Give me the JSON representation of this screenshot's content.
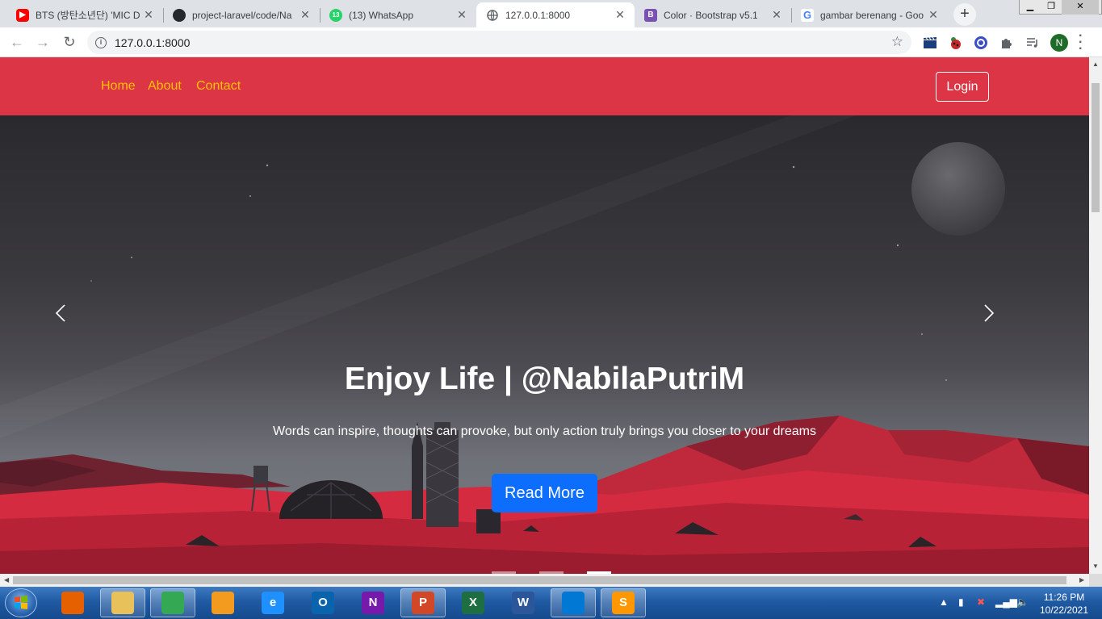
{
  "browser": {
    "tabs": [
      {
        "title": "BTS (방탄소년단) 'MIC D",
        "icon": "youtube-icon",
        "color": "#ff0000",
        "active": false
      },
      {
        "title": "project-laravel/code/Na",
        "icon": "github-icon",
        "color": "#24292e",
        "active": false
      },
      {
        "title": "(13) WhatsApp",
        "icon": "whatsapp-icon",
        "color": "#25d366",
        "badge": "13",
        "active": false
      },
      {
        "title": "127.0.0.1:8000",
        "icon": "globe-icon",
        "color": "#5f6368",
        "active": true
      },
      {
        "title": "Color · Bootstrap v5.1",
        "icon": "bootstrap-icon",
        "color": "#7952b3",
        "badge": "B",
        "active": false
      },
      {
        "title": "gambar berenang - Goo",
        "icon": "google-icon",
        "color": "#4285f4",
        "badge": "G",
        "active": false
      }
    ],
    "url": "127.0.0.1:8000",
    "profile_initial": "N"
  },
  "site": {
    "nav": {
      "links": [
        "Home",
        "About",
        "Contact"
      ],
      "login": "Login"
    },
    "hero": {
      "title": "Enjoy Life | @NabilaPutriM",
      "text": "Words can inspire, thoughts can provoke, but only action truly brings you closer to your dreams",
      "button": "Read More"
    },
    "carousel": {
      "slide_count": 3,
      "active_index": 2
    }
  },
  "colors": {
    "navbar": "#dc3545",
    "nav_link": "#ffc107",
    "button_primary": "#0d6efd"
  },
  "taskbar": {
    "apps": [
      {
        "name": "firefox-icon",
        "glyph": "",
        "color": "#e66000",
        "open": false
      },
      {
        "name": "file-explorer-icon",
        "glyph": "",
        "color": "#e8c15a",
        "open": true
      },
      {
        "name": "chrome-icon",
        "glyph": "",
        "color": "#34a853",
        "open": true
      },
      {
        "name": "media-player-icon",
        "glyph": "",
        "color": "#f29b1f",
        "open": false
      },
      {
        "name": "internet-explorer-icon",
        "glyph": "e",
        "color": "#1e90ff",
        "open": false
      },
      {
        "name": "outlook-icon",
        "glyph": "O",
        "color": "#0a64ad",
        "open": false
      },
      {
        "name": "onenote-icon",
        "glyph": "N",
        "color": "#7719aa",
        "open": false
      },
      {
        "name": "powerpoint-icon",
        "glyph": "P",
        "color": "#d24726",
        "open": true
      },
      {
        "name": "excel-icon",
        "glyph": "X",
        "color": "#1d6f42",
        "open": false
      },
      {
        "name": "word-icon",
        "glyph": "W",
        "color": "#2b579a",
        "open": false
      },
      {
        "name": "vscode-icon",
        "glyph": "",
        "color": "#0078d4",
        "open": true
      },
      {
        "name": "sublime-text-icon",
        "glyph": "S",
        "color": "#ff9800",
        "open": true
      }
    ],
    "time": "11:26 PM",
    "date": "10/22/2021"
  }
}
